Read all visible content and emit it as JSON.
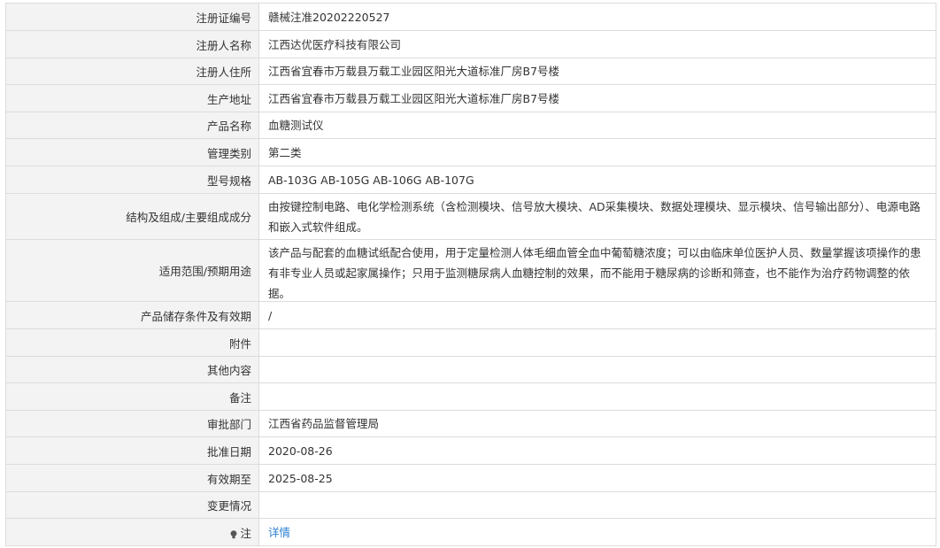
{
  "rows": [
    {
      "label": "注册证编号",
      "value": "赣械注准20202220527"
    },
    {
      "label": "注册人名称",
      "value": "江西达优医疗科技有限公司"
    },
    {
      "label": "注册人住所",
      "value": "江西省宜春市万载县万载工业园区阳光大道标准厂房B7号楼"
    },
    {
      "label": "生产地址",
      "value": "江西省宜春市万载县万载工业园区阳光大道标准厂房B7号楼"
    },
    {
      "label": "产品名称",
      "value": "血糖测试仪"
    },
    {
      "label": "管理类别",
      "value": "第二类"
    },
    {
      "label": "型号规格",
      "value": "AB-103G AB-105G AB-106G AB-107G"
    },
    {
      "label": "结构及组成/主要组成成分",
      "value": "由按键控制电路、电化学检测系统（含检测模块、信号放大模块、AD采集模块、数据处理模块、显示模块、信号输出部分）、电源电路和嵌入式软件组成。"
    },
    {
      "label": "适用范围/预期用途",
      "value": "该产品与配套的血糖试纸配合使用，用于定量检测人体毛细血管全血中葡萄糖浓度；可以由临床单位医护人员、数量掌握该项操作的患有非专业人员或起家属操作；只用于监测糖尿病人血糖控制的效果，而不能用于糖尿病的诊断和筛查，也不能作为治疗药物调整的依据。"
    },
    {
      "label": "产品储存条件及有效期",
      "value": "/"
    },
    {
      "label": "附件",
      "value": ""
    },
    {
      "label": "其他内容",
      "value": ""
    },
    {
      "label": "备注",
      "value": ""
    },
    {
      "label": "审批部门",
      "value": "江西省药品监督管理局"
    },
    {
      "label": "批准日期",
      "value": "2020-08-26"
    },
    {
      "label": "有效期至",
      "value": "2025-08-25"
    },
    {
      "label": "变更情况",
      "value": ""
    }
  ],
  "note": {
    "icon": "bulb-icon",
    "label": "注",
    "link_text": "详情",
    "link_color": "#2a7fd4"
  }
}
